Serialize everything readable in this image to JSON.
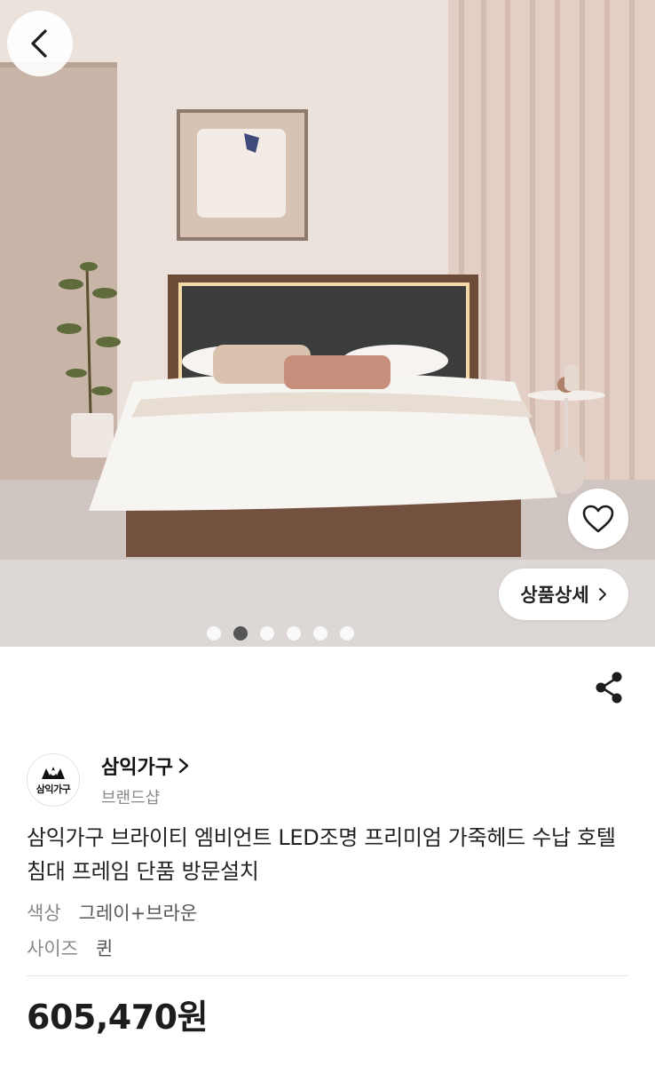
{
  "hero": {
    "back_icon": "chevron-left-icon",
    "wishlist_icon": "heart-outline-icon",
    "detail_button_label": "상품상세",
    "detail_button_icon": "chevron-right-icon",
    "carousel": {
      "total": 6,
      "active_index": 1
    }
  },
  "actions": {
    "share_icon": "share-icon"
  },
  "brand": {
    "logo_text": "삼익가구",
    "name": "삼익가구",
    "name_icon": "chevron-right-icon",
    "subtitle": "브랜드샵"
  },
  "product": {
    "title": "삼익가구 브라이티 엠비언트 LED조명 프리미엄 가죽헤드 수납 호텔 침대 프레임 단품 방문설치",
    "options": [
      {
        "key": "색상",
        "value": "그레이+브라운"
      },
      {
        "key": "사이즈",
        "value": "퀸"
      }
    ],
    "price": "605,470원"
  },
  "colors": {
    "accent_dot": "#555555",
    "muted_text": "#8a8a8a"
  }
}
